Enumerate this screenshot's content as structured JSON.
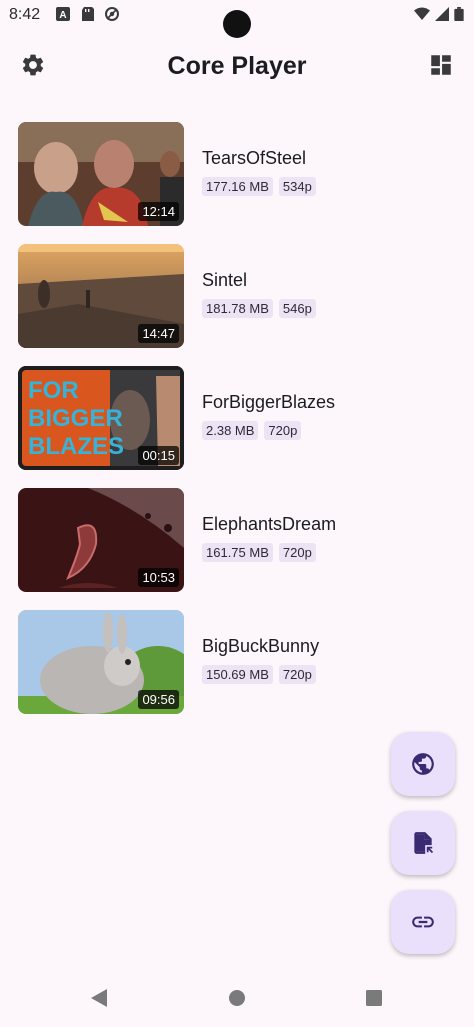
{
  "status_bar": {
    "time": "8:42"
  },
  "app_bar": {
    "title": "Core Player"
  },
  "videos": [
    {
      "title": "TearsOfSteel",
      "size": "177.16 MB",
      "resolution": "534p",
      "duration": "12:14"
    },
    {
      "title": "Sintel",
      "size": "181.78 MB",
      "resolution": "546p",
      "duration": "14:47"
    },
    {
      "title": "ForBiggerBlazes",
      "size": "2.38 MB",
      "resolution": "720p",
      "duration": "00:15",
      "thumb_text": [
        "FOR",
        "BIGGER",
        "BLAZES"
      ]
    },
    {
      "title": "ElephantsDream",
      "size": "161.75 MB",
      "resolution": "720p",
      "duration": "10:53"
    },
    {
      "title": "BigBuckBunny",
      "size": "150.69 MB",
      "resolution": "720p",
      "duration": "09:56"
    }
  ],
  "fabs": [
    {
      "icon": "globe-icon"
    },
    {
      "icon": "file-open-icon"
    },
    {
      "icon": "link-icon"
    }
  ],
  "colors": {
    "background": "#fdf7fb",
    "chip": "#ece3f4",
    "fab": "#eae0fb",
    "icon": "#3a2a72"
  }
}
